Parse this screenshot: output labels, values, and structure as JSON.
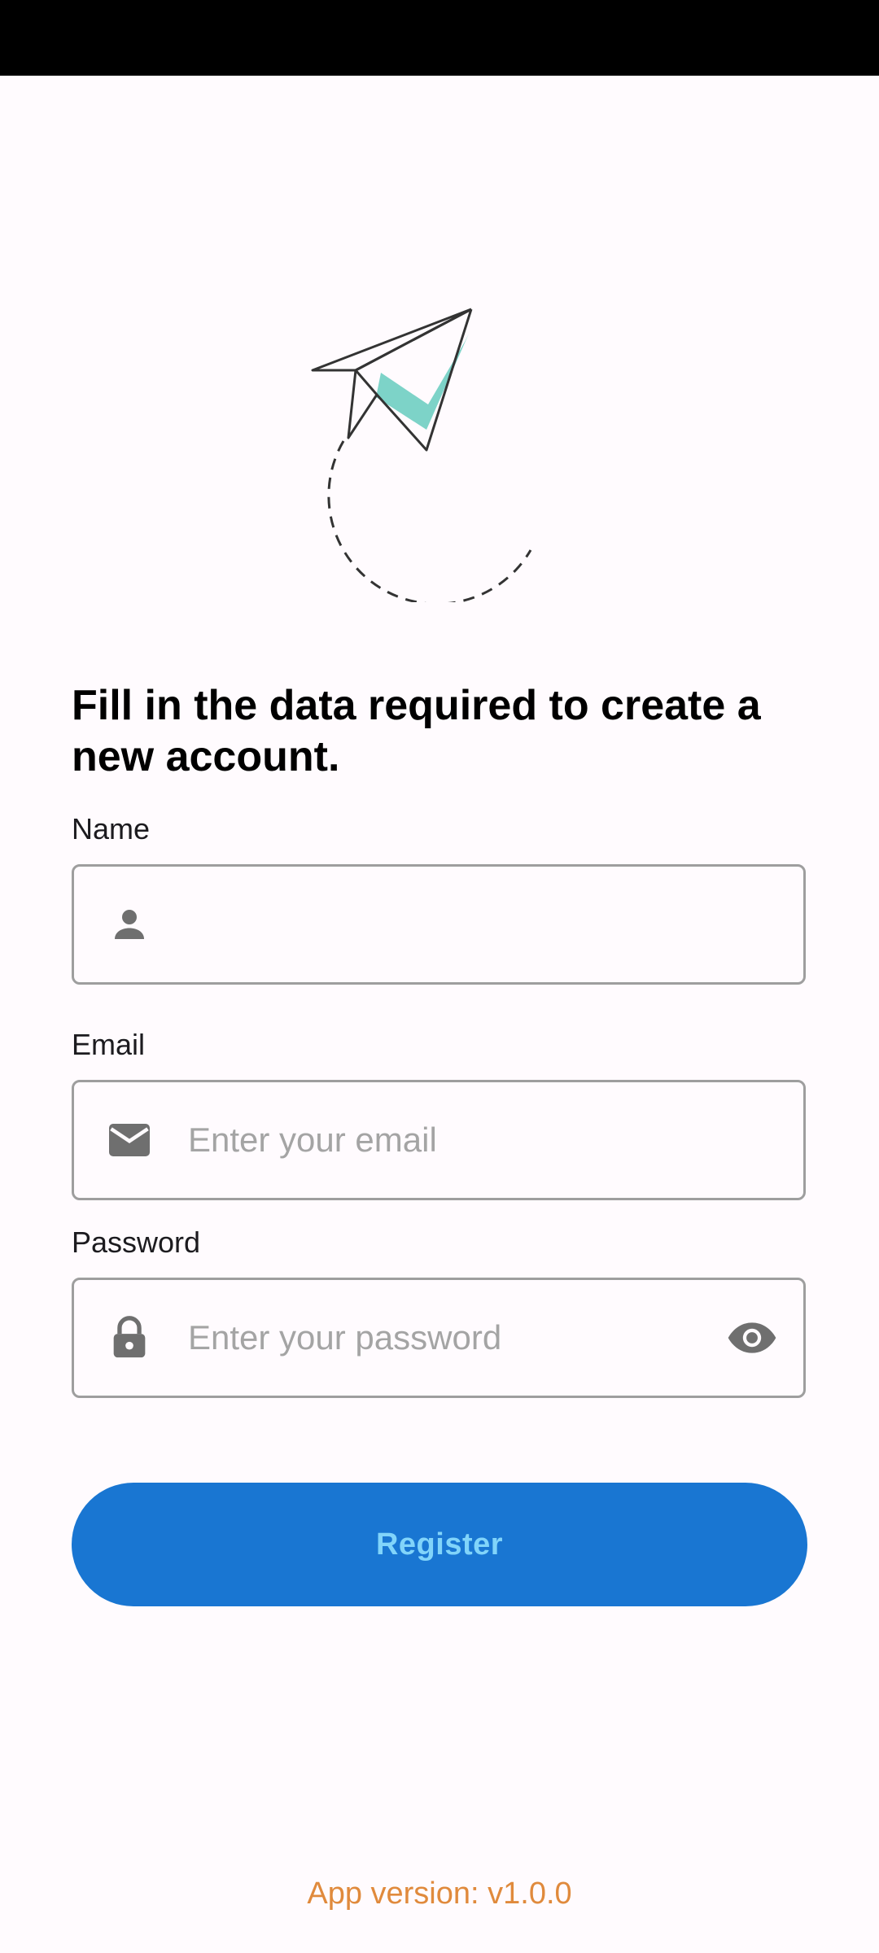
{
  "headline": "Fill in the data required to create a new account.",
  "form": {
    "name": {
      "label": "Name",
      "value": "",
      "placeholder": "",
      "icon": "person-icon"
    },
    "email": {
      "label": "Email",
      "value": "",
      "placeholder": "Enter your email",
      "icon": "mail-icon"
    },
    "password": {
      "label": "Password",
      "value": "",
      "placeholder": "Enter your password",
      "icon": "lock-icon",
      "toggle_icon": "eye-icon"
    }
  },
  "register_label": "Register",
  "footer": {
    "app_version": "App version: v1.0.0"
  },
  "colors": {
    "primary": "#1976d2",
    "button_text": "#81d4fa",
    "accent_teal": "#7dd3c8",
    "version_text": "#e08a3c",
    "background": "#fffbfe"
  }
}
